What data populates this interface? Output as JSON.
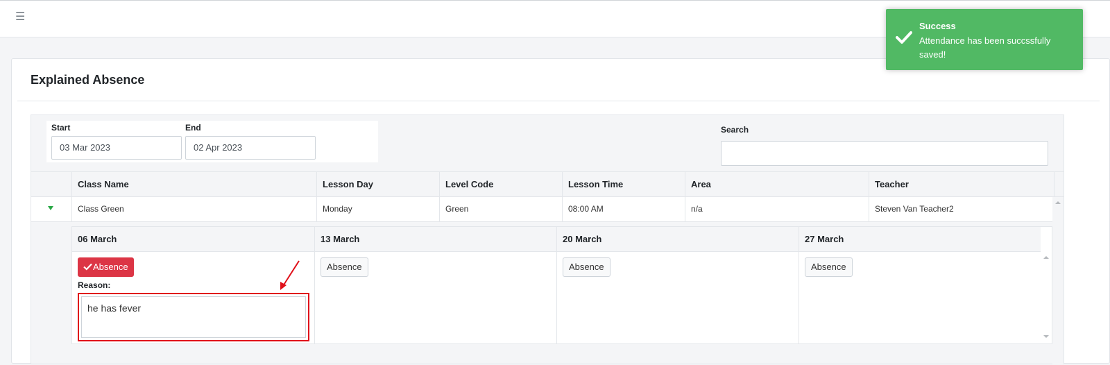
{
  "topbar": {
    "menu_icon": "hamburger-menu-icon"
  },
  "page": {
    "title": "Explained Absence"
  },
  "filters": {
    "start_label": "Start",
    "start_value": "03 Mar 2023",
    "end_label": "End",
    "end_value": "02 Apr 2023",
    "search_label": "Search",
    "search_value": ""
  },
  "table": {
    "columns": [
      "Class Name",
      "Lesson Day",
      "Level Code",
      "Lesson Time",
      "Area",
      "Teacher"
    ],
    "rows": [
      {
        "class_name": "Class Green",
        "lesson_day": "Monday",
        "level_code": "Green",
        "lesson_time": "08:00 AM",
        "area": "n/a",
        "teacher": "Steven Van Teacher2",
        "expanded": true
      }
    ]
  },
  "attendance": {
    "dates": [
      {
        "label": "06 March",
        "button": "Absence",
        "active": true,
        "reason_label": "Reason:",
        "reason_value": "he has fever"
      },
      {
        "label": "13 March",
        "button": "Absence",
        "active": false
      },
      {
        "label": "20 March",
        "button": "Absence",
        "active": false
      },
      {
        "label": "27 March",
        "button": "Absence",
        "active": false
      }
    ]
  },
  "toast": {
    "title": "Success",
    "message": "Attendance has been succssfully saved!",
    "icon": "checkmark-icon",
    "color": "#51b964"
  },
  "colors": {
    "absence_active": "#dc3545",
    "caret": "#28a745",
    "highlight": "#e0101a"
  }
}
